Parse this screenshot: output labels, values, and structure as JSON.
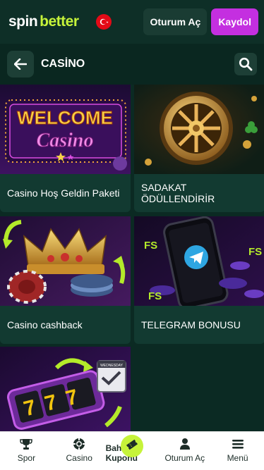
{
  "header": {
    "logo_part1": "spin",
    "logo_part2": "better",
    "login_label": "Oturum Aç",
    "register_label": "Kaydol"
  },
  "subbar": {
    "title": "CASİNO"
  },
  "cards": [
    {
      "label": "Casino Hoş Geldin Paketi",
      "image_text_1": "WELCOME",
      "image_text_2": "Casino"
    },
    {
      "label": "SADAKAT ÖDÜLLENDİRİR"
    },
    {
      "label": "Casino cashback"
    },
    {
      "label": "TELEGRAM BONUSU",
      "image_text_1": "FS",
      "image_text_2": "FS",
      "image_text_3": "FS"
    },
    {
      "label": "",
      "image_text_1": "777",
      "image_text_2": "WEDNESDAY"
    }
  ],
  "nav": {
    "items": [
      {
        "label": "Spor",
        "icon": "trophy-icon"
      },
      {
        "label": "Casino",
        "icon": "casino-chip-icon"
      },
      {
        "label": "Bahis Kuponu",
        "icon": "ticket-icon"
      },
      {
        "label": "Oturum Aç",
        "icon": "user-icon"
      },
      {
        "label": "Menü",
        "icon": "menu-icon"
      }
    ]
  },
  "colors": {
    "accent": "#c6f33a",
    "register": "#c42fe0",
    "background": "#0b2a23",
    "card": "#123a31"
  }
}
